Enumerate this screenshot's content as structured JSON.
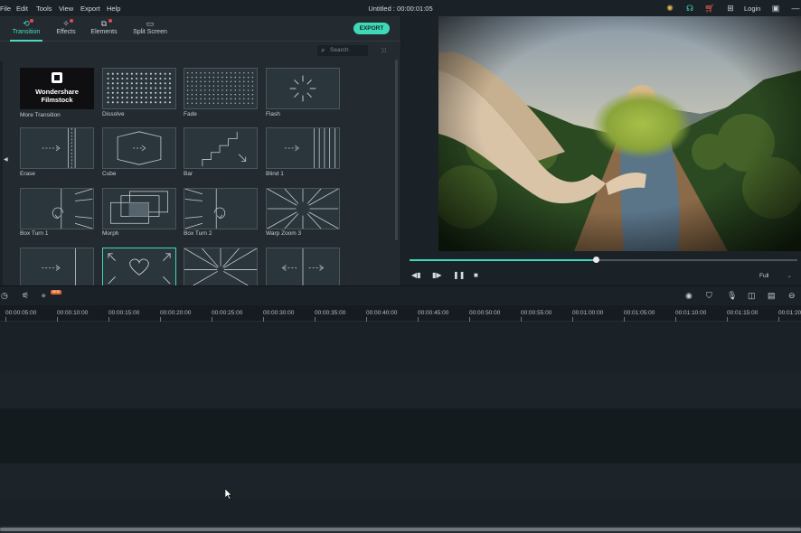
{
  "menubar": {
    "items": [
      "File",
      "Edit",
      "Tools",
      "View",
      "Export",
      "Help"
    ],
    "title": "Untitled : 00:00:01:05",
    "login": "Login",
    "icons": [
      "bulb-icon",
      "headset-icon",
      "cart-icon",
      "gift-icon",
      "save-icon",
      "minimize-icon"
    ]
  },
  "tabs": [
    {
      "label": "Transition",
      "icon": "transition-icon",
      "active": true,
      "dot": true
    },
    {
      "label": "Effects",
      "icon": "effects-icon",
      "active": false,
      "dot": true
    },
    {
      "label": "Elements",
      "icon": "elements-icon",
      "active": false,
      "dot": true
    },
    {
      "label": "Split Screen",
      "icon": "split-screen-icon",
      "active": false,
      "dot": false
    }
  ],
  "export_label": "EXPORT",
  "search": {
    "placeholder": "Search"
  },
  "brand": {
    "line1": "Wondershare",
    "line2": "Filmstock"
  },
  "transitions": [
    {
      "label": "More Transition",
      "icon": "filmstock-logo"
    },
    {
      "label": "Dissolve",
      "icon": "dissolve-icon"
    },
    {
      "label": "Fade",
      "icon": "fade-icon"
    },
    {
      "label": "Flash",
      "icon": "flash-icon"
    },
    {
      "label": "Erase",
      "icon": "erase-icon"
    },
    {
      "label": "Cube",
      "icon": "cube-icon"
    },
    {
      "label": "Bar",
      "icon": "bar-icon"
    },
    {
      "label": "Blind 1",
      "icon": "blind-icon"
    },
    {
      "label": "Box Turn 1",
      "icon": "box-turn-icon"
    },
    {
      "label": "Morph",
      "icon": "morph-icon"
    },
    {
      "label": "Box Turn 2",
      "icon": "box-turn-icon"
    },
    {
      "label": "Warp Zoom 3",
      "icon": "warp-zoom-icon"
    },
    {
      "label": "",
      "icon": "slide-icon"
    },
    {
      "label": "",
      "icon": "heart-icon",
      "selected": true
    },
    {
      "label": "",
      "icon": "zoom-burst-icon"
    },
    {
      "label": "",
      "icon": "split-icon"
    }
  ],
  "player": {
    "progress": 0.48,
    "quality": "Full",
    "controls": [
      "step-back-icon",
      "play-icon",
      "pause-icon",
      "stop-icon"
    ]
  },
  "timeline": {
    "ticks": [
      "00:00:05:00",
      "00:00:10:00",
      "00:00:15:00",
      "00:00:20:00",
      "00:00:25:00",
      "00:00:30:00",
      "00:00:35:00",
      "00:00:40:00",
      "00:00:45:00",
      "00:00:50:00",
      "00:00:55:00",
      "00:01:00:00",
      "00:01:05:00",
      "00:01:10:00",
      "00:01:15:00",
      "00:01:20"
    ],
    "new_badge": "NEW"
  },
  "colors": {
    "accent": "#3fd9b8",
    "badge": "#e64b4b"
  }
}
